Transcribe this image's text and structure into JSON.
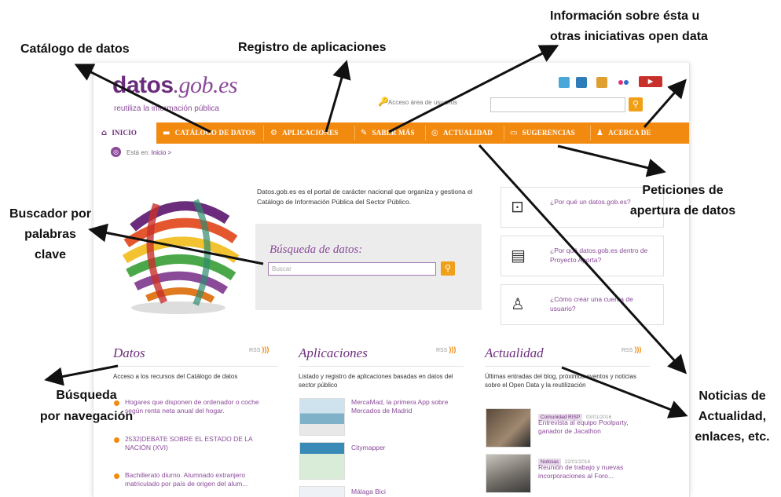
{
  "site": {
    "logo": {
      "brand": "datos",
      "domain": ".gob.es",
      "tagline": "reutiliza la información pública"
    },
    "social_icons": [
      "twitter-icon",
      "linkedin-icon",
      "sharing-icon",
      "flickr-icon",
      "youtube-icon"
    ],
    "access_link": "Acceso área de usuarios",
    "nav": [
      {
        "label": "INICIO",
        "icon": "home-icon"
      },
      {
        "label": "CATÁLOGO DE DATOS",
        "icon": "folder-icon"
      },
      {
        "label": "APLICACIONES",
        "icon": "gear-icon"
      },
      {
        "label": "SABER MÁS",
        "icon": "pin-icon"
      },
      {
        "label": "ACTUALIDAD",
        "icon": "globe-icon"
      },
      {
        "label": "SUGERENCIAS",
        "icon": "comment-icon"
      },
      {
        "label": "ACERCA DE",
        "icon": "user-icon"
      }
    ],
    "breadcrumb": {
      "prefix": "Está en:",
      "current": "Inicio >"
    },
    "intro": "Datos.gob.es es el portal de carácter nacional que organiza y gestiona el Catálogo de Información Pública del Sector Público.",
    "search": {
      "title": "Búsqueda de datos:",
      "placeholder": "Buscar"
    },
    "faq": [
      {
        "text": "¿Por qué un datos.gob.es?",
        "icon": "settings-window-icon"
      },
      {
        "text": "¿Por qué datos.gob.es dentro de Proyecto Aporta?",
        "icon": "document-play-icon"
      },
      {
        "text": "¿Cómo crear una cuenta de usuario?",
        "icon": "person-info-icon"
      }
    ],
    "columns": {
      "datos": {
        "title": "Datos",
        "rss": "RSS",
        "desc": "Acceso a los recursos del Catálogo de datos",
        "items": [
          "Hogares que disponen de ordenador o coche según renta neta anual del hogar.",
          "2532|DEBATE SOBRE EL ESTADO DE LA NACIÓN (XVI)",
          "Bachillerato diurno. Alumnado extranjero matriculado por país de origen del alum..."
        ]
      },
      "aplicaciones": {
        "title": "Aplicaciones",
        "rss": "RSS",
        "desc": "Listado y registro de aplicaciones basadas en datos del sector público",
        "items": [
          "MercaMad, la primera App sobre Mercados de Madrid",
          "Citymapper",
          "Málaga Bici"
        ]
      },
      "actualidad": {
        "title": "Actualidad",
        "rss": "RSS",
        "desc": "Últimas entradas del blog, próximos eventos y noticias sobre el Open Data y la reutilización",
        "items": [
          {
            "badge": "Comunidad RISP",
            "date": "03/01/2016",
            "text": "Entrevista al equipo Poolparty, ganador de Jacathon"
          },
          {
            "badge": "Noticias",
            "date": "22/01/2016",
            "text": "Reunión de trabajo y nuevas incorporaciones al Foro..."
          }
        ]
      }
    }
  },
  "annotations": {
    "catalogo": "Catálogo de datos",
    "registro": "Registro de aplicaciones",
    "informacion": [
      "Información sobre ésta u",
      "otras iniciativas open data"
    ],
    "buscador": [
      "Buscador por",
      "palabras",
      "clave"
    ],
    "peticiones": [
      "Peticiones de",
      "apertura de datos"
    ],
    "busqueda_nav": [
      "Búsqueda",
      "por navegación"
    ],
    "noticias": [
      "Noticias de",
      "Actualidad,",
      "enlaces, etc."
    ]
  },
  "colors": {
    "brand_purple": "#6b2d7b",
    "nav_orange": "#f28a10",
    "link_purple": "#8a4a98"
  }
}
